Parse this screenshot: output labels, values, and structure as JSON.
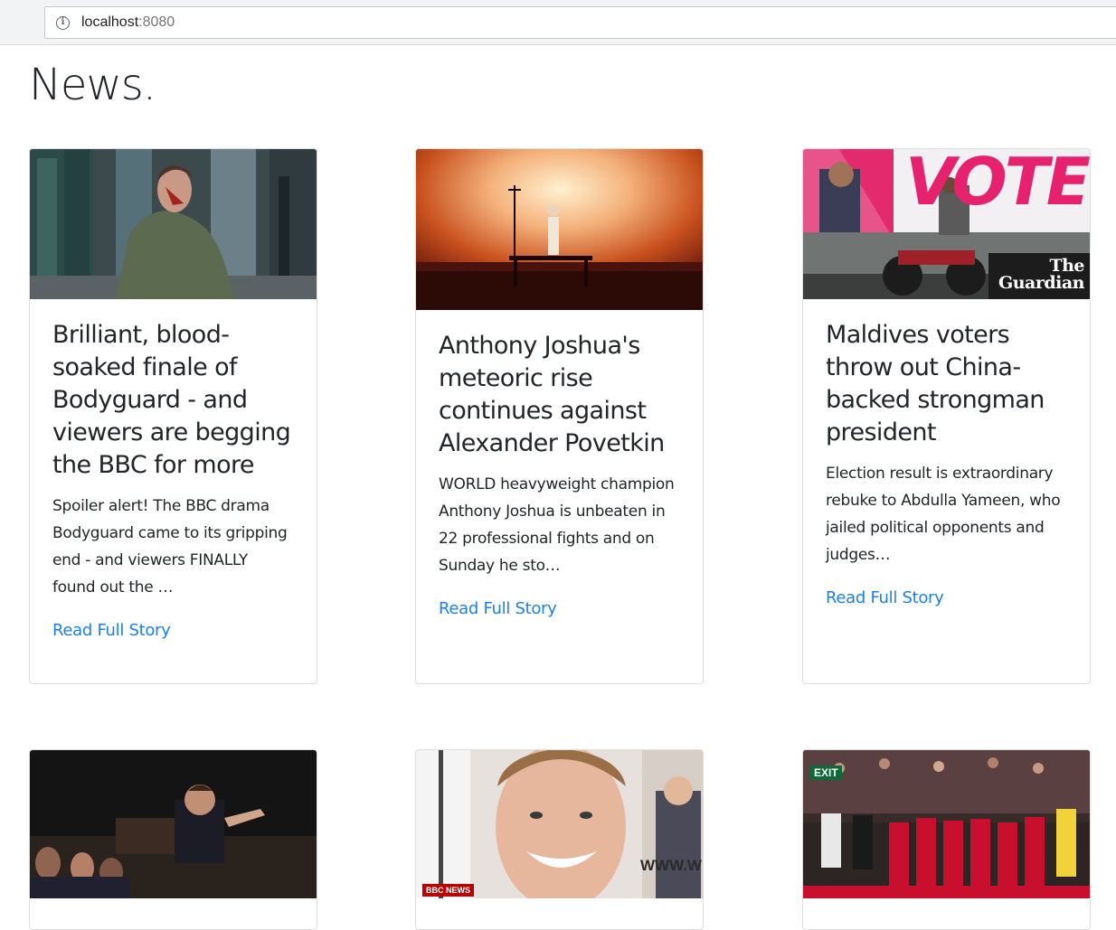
{
  "browser": {
    "url_host": "localhost",
    "url_port": ":8080"
  },
  "page": {
    "title": "News."
  },
  "cards": [
    {
      "title": "Brilliant, blood-soaked finale of Bodyguard - and viewers are begging the BBC for more",
      "description": "Spoiler alert! The BBC drama Bodyguard came to its gripping end - and viewers FINALLY found out the …",
      "link_label": "Read Full Story"
    },
    {
      "title": "Anthony Joshua's meteoric rise continues against Alexander Povetkin",
      "description": "WORLD heavyweight champion Anthony Joshua is unbeaten in 22 professional fights and on Sunday he sto…",
      "link_label": "Read Full Story"
    },
    {
      "title": "Maldives voters throw out China-backed strongman president",
      "description": "Election result is extraordinary rebuke to Abdulla Yameen, who jailed political opponents and judges…",
      "link_label": "Read Full Story",
      "image_text": "VOTE",
      "logo_top": "The",
      "logo_bottom": "Guardian"
    },
    {},
    {
      "image_text": "WWW.WE",
      "logo": "BBC NEWS"
    },
    {
      "image_text": "EXIT"
    }
  ],
  "colors": {
    "link": "#1a7ff0",
    "text": "#212529"
  }
}
